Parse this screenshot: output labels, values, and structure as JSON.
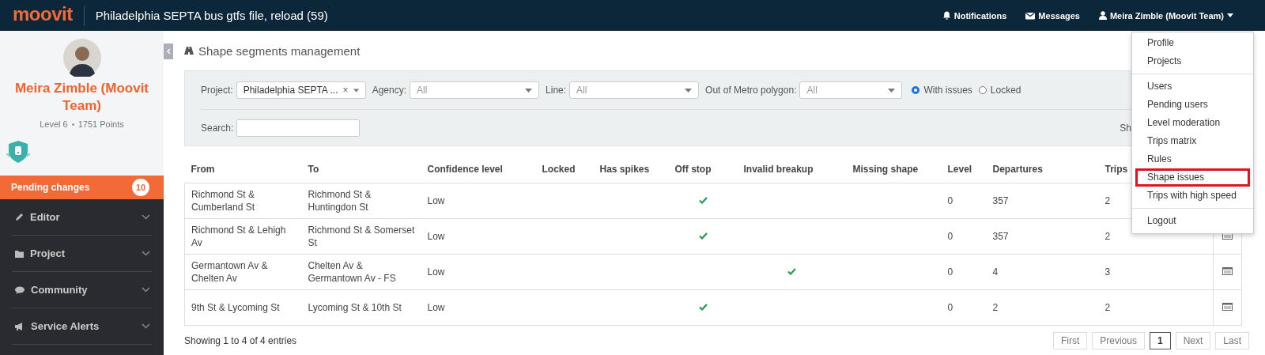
{
  "topbar": {
    "logo": "moovit",
    "title": "Philadelphia SEPTA bus gtfs file, reload (59)",
    "links": [
      {
        "label": "Notifications"
      },
      {
        "label": "Messages"
      }
    ],
    "user_menu": "Meira Zimble (Moovit Team)"
  },
  "profile": {
    "name": "Meira Zimble (Moovit Team)",
    "level": "Level 6",
    "points": "1751 Points"
  },
  "pending": {
    "label": "Pending changes",
    "count": "10"
  },
  "sidebar": {
    "items": [
      {
        "label": "Editor"
      },
      {
        "label": "Project"
      },
      {
        "label": "Community"
      },
      {
        "label": "Service Alerts"
      }
    ]
  },
  "page_title": "Shape segments management",
  "filters": {
    "project": {
      "label": "Project:",
      "value": "Philadelphia SEPTA ...",
      "clear": "×"
    },
    "agency": {
      "label": "Agency:",
      "placeholder": "All"
    },
    "line": {
      "label": "Line:",
      "placeholder": "All"
    },
    "metro": {
      "label": "Out of Metro polygon:",
      "placeholder": "All"
    },
    "radios": [
      {
        "label": "With issues",
        "selected": true
      },
      {
        "label": "Locked",
        "selected": false
      }
    ],
    "search": {
      "label": "Search:"
    },
    "show_label": "Sh"
  },
  "table": {
    "columns": [
      "From",
      "To",
      "Confidence level",
      "Locked",
      "Has spikes",
      "Off stop",
      "Invalid breakup",
      "Missing shape",
      "Level",
      "Departures",
      "Trips"
    ],
    "rows": [
      {
        "from": "Richmond St & Cumberland St",
        "to": "Richmond St & Huntingdon St",
        "confidence": "Low",
        "locked": false,
        "has_spikes": false,
        "off_stop": true,
        "invalid_breakup": false,
        "missing_shape": false,
        "level": "0",
        "departures": "357",
        "trips": "2"
      },
      {
        "from": "Richmond St & Lehigh Av",
        "to": "Richmond St & Somerset St",
        "confidence": "Low",
        "locked": false,
        "has_spikes": false,
        "off_stop": true,
        "invalid_breakup": false,
        "missing_shape": false,
        "level": "0",
        "departures": "357",
        "trips": "2"
      },
      {
        "from": "Germantown Av & Chelten Av",
        "to": "Chelten Av & Germantown Av - FS",
        "confidence": "Low",
        "locked": false,
        "has_spikes": false,
        "off_stop": false,
        "invalid_breakup": true,
        "missing_shape": false,
        "level": "0",
        "departures": "4",
        "trips": "3"
      },
      {
        "from": "9th St & Lycoming St",
        "to": "Lycoming St & 10th St",
        "confidence": "Low",
        "locked": false,
        "has_spikes": false,
        "off_stop": true,
        "invalid_breakup": false,
        "missing_shape": false,
        "level": "0",
        "departures": "2",
        "trips": "2"
      }
    ]
  },
  "info": "Showing 1 to 4 of 4 entries",
  "pagination": [
    {
      "label": "First",
      "selected": false
    },
    {
      "label": "Previous",
      "selected": false
    },
    {
      "label": "1",
      "selected": true
    },
    {
      "label": "Next",
      "selected": false
    },
    {
      "label": "Last",
      "selected": false
    }
  ],
  "dropdown": {
    "groups": [
      [
        {
          "label": "Profile",
          "highlighted": false
        },
        {
          "label": "Projects",
          "highlighted": false
        }
      ],
      [
        {
          "label": "Users",
          "highlighted": false
        },
        {
          "label": "Pending users",
          "highlighted": false
        },
        {
          "label": "Level moderation",
          "highlighted": false
        },
        {
          "label": "Trips matrix",
          "highlighted": false
        },
        {
          "label": "Rules",
          "highlighted": false
        },
        {
          "label": "Shape issues",
          "highlighted": true
        },
        {
          "label": "Trips with high speed",
          "highlighted": false
        }
      ],
      [
        {
          "label": "Logout",
          "highlighted": false
        }
      ]
    ]
  }
}
